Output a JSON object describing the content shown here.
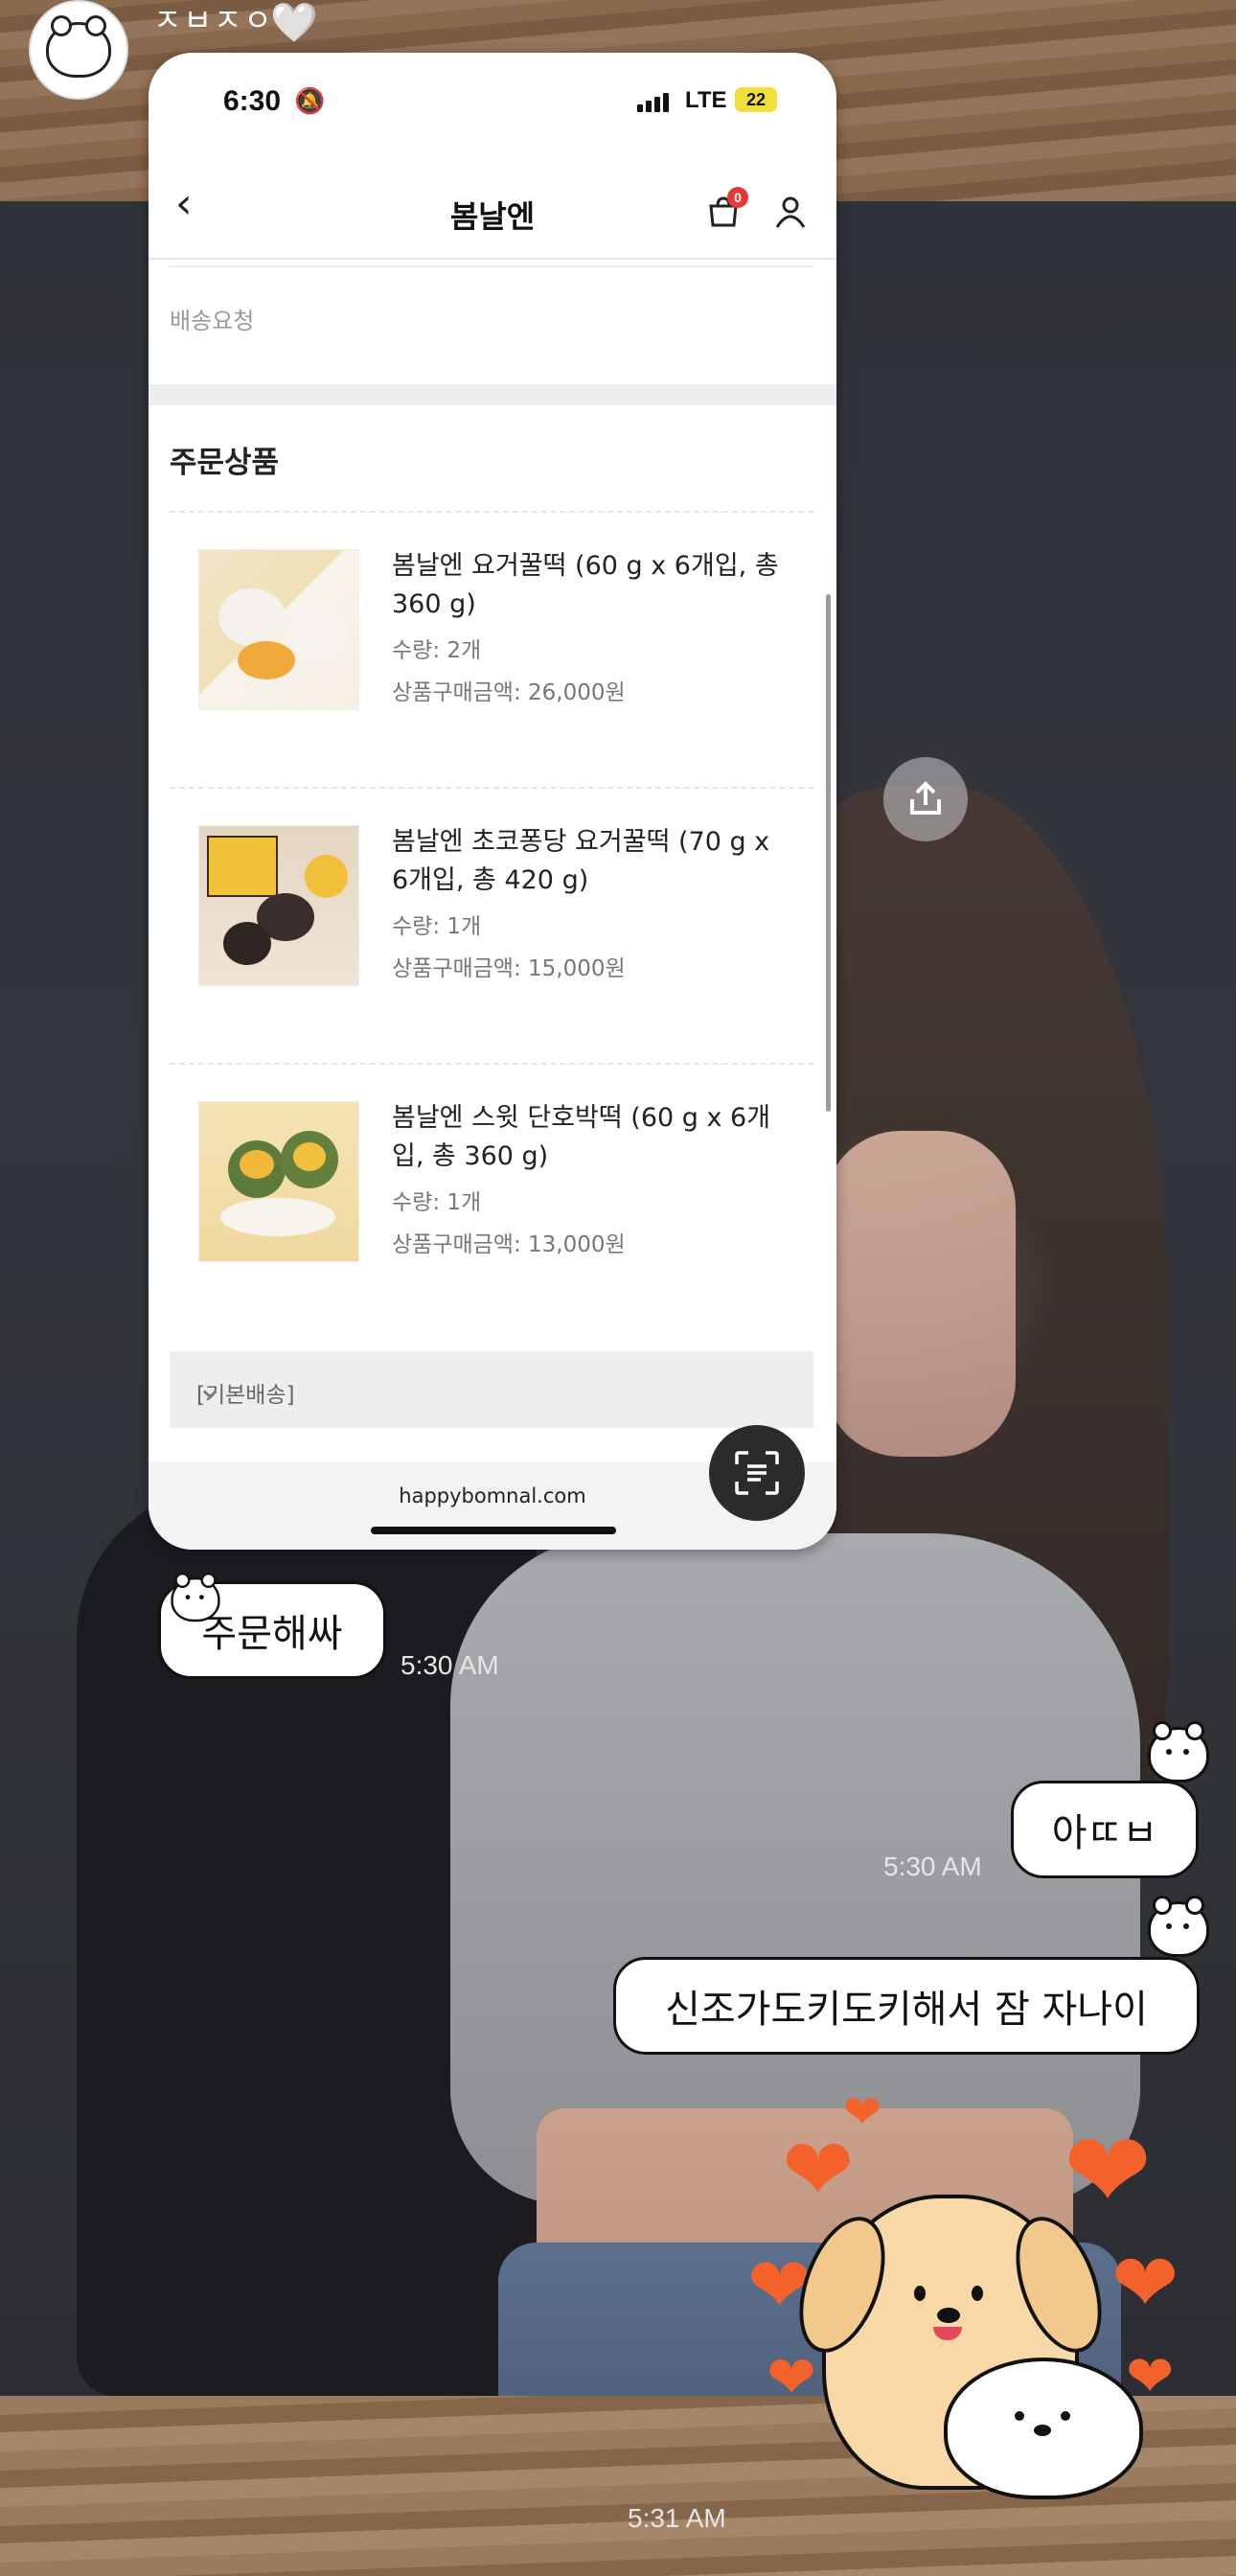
{
  "story": {
    "name": "ㅈㅂㅈㅇ",
    "heart": "🤍"
  },
  "status_bar": {
    "time": "6:30",
    "bell": "🔕",
    "network": "LTE",
    "battery": "22"
  },
  "nav": {
    "back": "‹",
    "title": "봄날엔",
    "cart_count": "0"
  },
  "delivery_request_label": "배송요청",
  "section_title": "주문상품",
  "items": [
    {
      "name": "봄날엔 요거꿀떡 (60 g x 6개입, 총 360 g)",
      "qty": "수량: 2개",
      "price": "상품구매금액: 26,000원"
    },
    {
      "name": "봄날엔 초코퐁당 요거꿀떡 (70 g x 6개입, 총 420 g)",
      "qty": "수량: 1개",
      "price": "상품구매금액: 15,000원"
    },
    {
      "name": "봄날엔 스윗 단호박떡 (60 g x 6개입, 총 360 g)",
      "qty": "수량: 1개",
      "price": "상품구매금액: 13,000원"
    }
  ],
  "shipping_label": "[기본배송]",
  "url": "happybomnal.com",
  "chat": {
    "msg1": "주문해싸",
    "ts1": "5:30 AM",
    "msg2": "아ㄸㅂ",
    "ts2": "5:30 AM",
    "msg3": "신조가도키도키해서 잠 자나이",
    "ts3": "5:31 AM"
  },
  "colors": {
    "heart": "#f4622c",
    "badge": "#e53935",
    "battery": "#f3df3b"
  },
  "icons": [
    "back-icon",
    "cart-icon",
    "user-icon",
    "scan-icon",
    "share-icon",
    "chevron-down-icon",
    "bell-off-icon"
  ]
}
